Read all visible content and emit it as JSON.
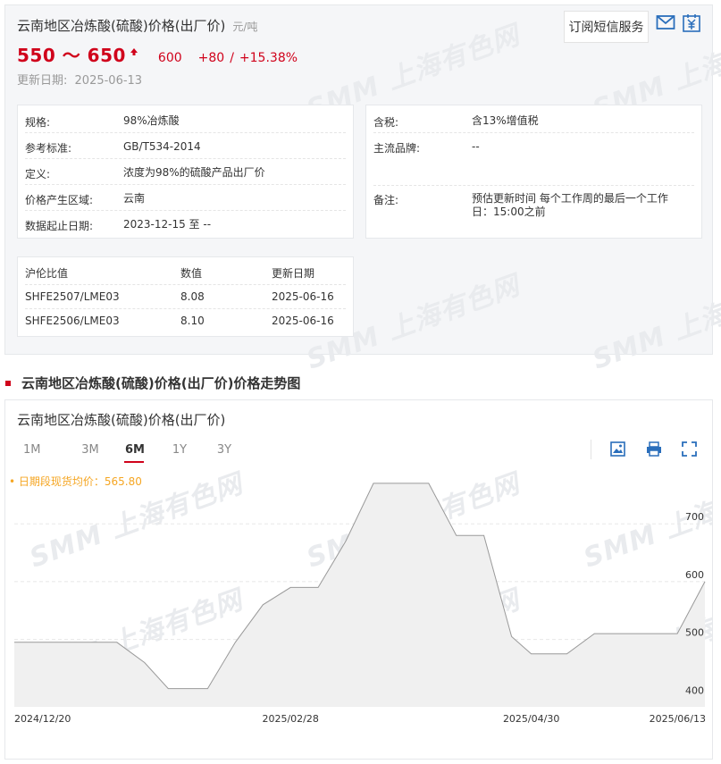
{
  "header": {
    "title": "云南地区冶炼酸(硫酸)价格(出厂价)",
    "unit": "元/吨",
    "price_range": "550 ～ 650",
    "prev_avg": "600",
    "change": "+80",
    "slash": "/",
    "change_pct": "+15.38%",
    "update_label": "更新日期:",
    "update_date": "2025-06-13",
    "subscribe_label": "订阅短信服务",
    "watermark": "SMM 上海有色网"
  },
  "details_left": [
    {
      "key": "规格:",
      "value": "98%冶炼酸"
    },
    {
      "key": "参考标准:",
      "value": "GB/T534-2014"
    },
    {
      "key": "定义:",
      "value": "浓度为98%的硫酸产品出厂价"
    },
    {
      "key": "价格产生区域:",
      "value": "云南"
    },
    {
      "key": "数据起止日期:",
      "value": "2023-12-15 至 --"
    }
  ],
  "details_right": [
    {
      "key": "含税:",
      "value": "含13%增值税"
    },
    {
      "key": "主流品牌:",
      "value": "--"
    },
    {
      "key": "备注:",
      "value": "预估更新时间 每个工作周的最后一个工作日：15:00之前"
    }
  ],
  "ratio_table": {
    "headers": [
      "沪伦比值",
      "数值",
      "更新日期"
    ],
    "rows": [
      [
        "SHFE2507/LME03",
        "8.08",
        "2025-06-16"
      ],
      [
        "SHFE2506/LME03",
        "8.10",
        "2025-06-16"
      ]
    ]
  },
  "section_title": "云南地区冶炼酸(硫酸)价格(出厂价)价格走势图",
  "chart_panel": {
    "title": "云南地区冶炼酸(硫酸)价格(出厂价)",
    "tabs": [
      "1M",
      "3M",
      "6M",
      "1Y",
      "3Y"
    ],
    "active_tab": "6M",
    "avg_label": "• 日期段现货均价：565.80",
    "tools": [
      "image-download-icon",
      "print-icon",
      "fullscreen-icon"
    ]
  },
  "chart_data": {
    "type": "area",
    "x": [
      "2024-12-20",
      "2025-01-13",
      "2025-01-15",
      "2025-01-22",
      "2025-01-28",
      "2025-02-07",
      "2025-02-14",
      "2025-02-21",
      "2025-02-28",
      "2025-03-07",
      "2025-03-14",
      "2025-03-21",
      "2025-03-28",
      "2025-04-04",
      "2025-04-11",
      "2025-04-18",
      "2025-04-25",
      "2025-04-30",
      "2025-05-09",
      "2025-05-16",
      "2025-05-23",
      "2025-05-30",
      "2025-06-06",
      "2025-06-13"
    ],
    "values": [
      495,
      495,
      495,
      460,
      415,
      415,
      495,
      560,
      590,
      590,
      670,
      770,
      770,
      770,
      680,
      680,
      505,
      475,
      475,
      510,
      510,
      510,
      510,
      600
    ],
    "xticks": [
      "2024/12/20",
      "2025/02/28",
      "2025/04/30",
      "2025/06/13"
    ],
    "yticks": [
      400,
      500,
      600,
      700
    ],
    "ylim": [
      385,
      790
    ],
    "grid": true,
    "line_color": "#999999",
    "fill_color": "#f0f0f0"
  },
  "colors": {
    "accent_red": "#d0021b",
    "avg_orange": "#f5a623",
    "icon_blue": "#2a6ebb"
  }
}
